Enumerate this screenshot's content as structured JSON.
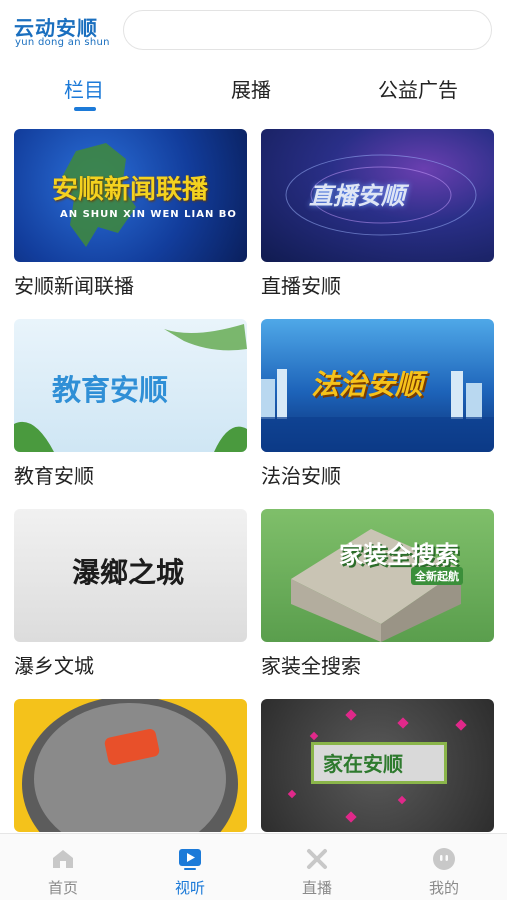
{
  "header": {
    "logo_cn": "云动安顺",
    "logo_en": "yun dong  an  shun",
    "search_placeholder": ""
  },
  "tabs": [
    {
      "label": "栏目",
      "active": true
    },
    {
      "label": "展播",
      "active": false
    },
    {
      "label": "公益广告",
      "active": false
    }
  ],
  "cards": [
    {
      "title": "安顺新闻联播",
      "thumb_text": "安顺新闻联播",
      "thumb_sub": "AN SHUN XIN WEN LIAN BO"
    },
    {
      "title": "直播安顺",
      "thumb_text": "直播安顺"
    },
    {
      "title": "教育安顺",
      "thumb_text": "教育安顺"
    },
    {
      "title": "法治安顺",
      "thumb_text": "法治安顺"
    },
    {
      "title": "瀑乡文城",
      "thumb_text": "瀑鄉之城"
    },
    {
      "title": "家装全搜索",
      "thumb_text": "家装全搜索",
      "thumb_sub": "全新起航"
    },
    {
      "title": "",
      "thumb_text": ""
    },
    {
      "title": "",
      "thumb_text": "家在安顺"
    }
  ],
  "bottom_nav": [
    {
      "label": "首页",
      "icon": "home-icon",
      "active": false
    },
    {
      "label": "视听",
      "icon": "video-play-icon",
      "active": true
    },
    {
      "label": "直播",
      "icon": "live-icon",
      "active": false
    },
    {
      "label": "我的",
      "icon": "profile-icon",
      "active": false
    }
  ],
  "colors": {
    "accent": "#1c7ad8",
    "logo": "#1a6fbf",
    "inactive": "#8a8a8a"
  }
}
